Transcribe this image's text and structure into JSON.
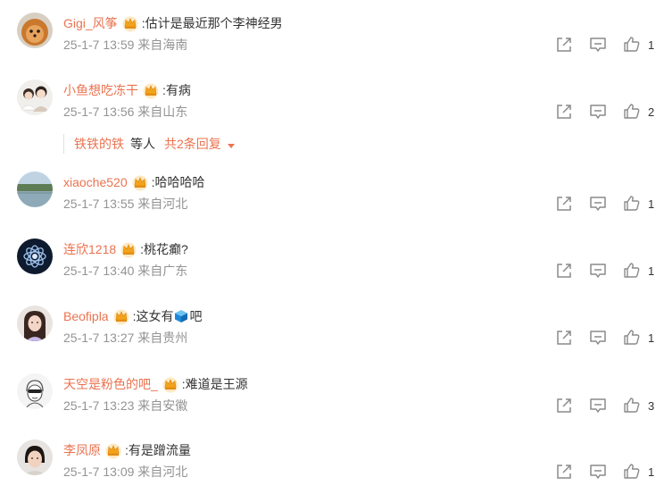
{
  "comments": [
    {
      "username": "Gigi_风筝",
      "text": ":估计是最近那个李神经男",
      "time": "25-1-7 13:59",
      "location": "来自海南",
      "likes": "1"
    },
    {
      "username": "小鱼想吃冻干",
      "text": ":有病",
      "time": "25-1-7 13:56",
      "location": "来自山东",
      "likes": "2"
    },
    {
      "username": "xiaoche520",
      "text": ":哈哈哈哈",
      "time": "25-1-7 13:55",
      "location": "来自河北",
      "likes": "1"
    },
    {
      "username": "连欣1218",
      "text": ":桃花癫?",
      "time": "25-1-7 13:40",
      "location": "来自广东",
      "likes": "1"
    },
    {
      "username": "Beofipla",
      "text_before": ":这女有",
      "emoji": "blue-box-emoji",
      "text_after": "吧",
      "time": "25-1-7 13:27",
      "location": "来自贵州",
      "likes": "1"
    },
    {
      "username": "天空是粉色的吧_",
      "text": ":难道是王源",
      "time": "25-1-7 13:23",
      "location": "来自安徽",
      "likes": "3"
    },
    {
      "username": "李凤原",
      "text": ":有是蹭流量",
      "time": "25-1-7 13:09",
      "location": "来自河北",
      "likes": "1"
    }
  ],
  "replies_preview": {
    "user": "铁铁的铁",
    "etc": "等人",
    "total": "共2条回复"
  },
  "icons": {
    "share": "share-icon",
    "comment": "comment-icon",
    "like": "thumbs-up-icon",
    "vip": "vip-crown-icon",
    "expand": "caret-down-icon"
  },
  "colors": {
    "username": "#eb7350",
    "meta": "#939393",
    "icon": "#8a8a8a",
    "text": "#333333"
  }
}
